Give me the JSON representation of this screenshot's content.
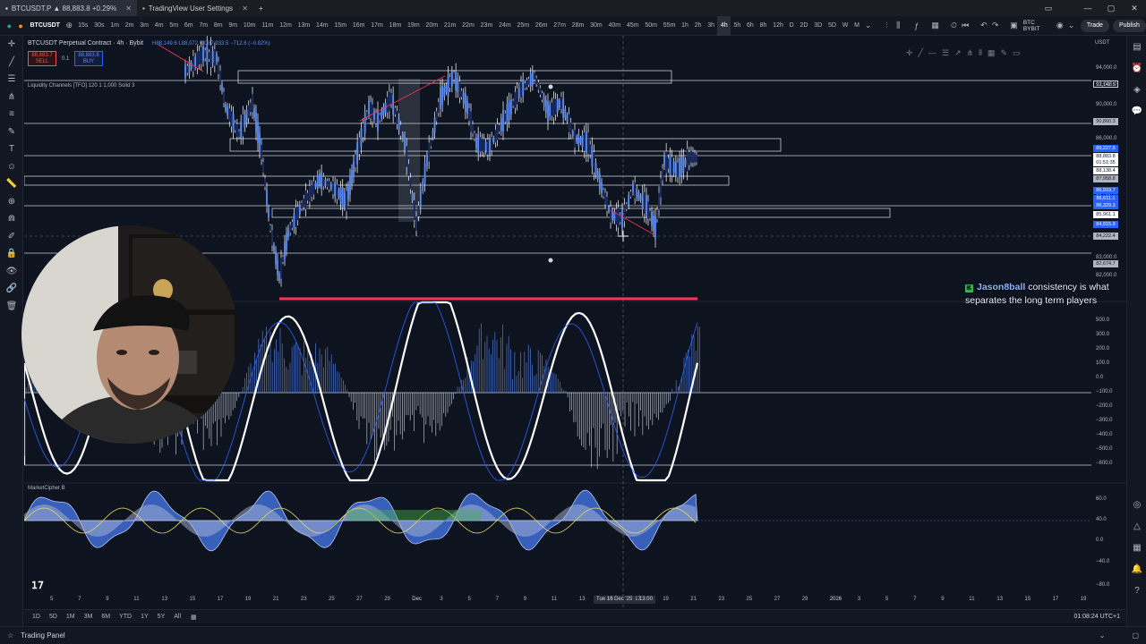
{
  "browser": {
    "tabs": [
      {
        "label": "BTCUSDT.P ▲ 88,883.8 +0.29%"
      },
      {
        "label": "TradingView User Settings"
      }
    ]
  },
  "toolbar": {
    "symbol": "BTCUSDT",
    "timeframes": [
      "15s",
      "30s",
      "1m",
      "2m",
      "3m",
      "4m",
      "5m",
      "6m",
      "7m",
      "8m",
      "9m",
      "10m",
      "11m",
      "12m",
      "13m",
      "14m",
      "15m",
      "16m",
      "17m",
      "18m",
      "19m",
      "20m",
      "21m",
      "22m",
      "23m",
      "24m",
      "25m",
      "26m",
      "27m",
      "28m",
      "30m",
      "40m",
      "45m",
      "50m",
      "55m",
      "1h",
      "2h",
      "3h",
      "4h",
      "5h",
      "6h",
      "8h",
      "12h",
      "D",
      "2D",
      "3D",
      "5D",
      "W",
      "M"
    ],
    "active_timeframe": "4h",
    "exchange_label": "BTC BYBIT",
    "trade_label": "Trade",
    "publish_label": "Publish",
    "currency": "USDT"
  },
  "legend": {
    "title": "BTCUSDT Perpetual Contract · 4h · Bybit",
    "ohlc": "H88,149.6  L88,072.0  C87,933.5 −712.6 (−0.82%)",
    "sell_price": "88,883.7",
    "sell_label": "SELL",
    "spread": "0.1",
    "buy_price": "88,883.8",
    "buy_label": "BUY",
    "indicator": "Liquidity Channels [TFO] 120 1 1,000 Solid 3",
    "oscillator": "MarketCipher B"
  },
  "price_axis": {
    "labels": [
      "94,000.0",
      "92,000.0",
      "90,000.0",
      "88,000.0",
      "86,000.0",
      "84,000.0",
      "83,000.0",
      "82,000.0"
    ],
    "tags": [
      {
        "text": "93,142.5",
        "color": "#d1d4dc",
        "bg": "#d1d4dc"
      },
      {
        "text": "90,860.3",
        "color": "#131722",
        "bg": "#b2b5be"
      },
      {
        "text": "89,227.5",
        "color": "#ffffff",
        "bg": "#2962ff"
      },
      {
        "text": "88,883.8",
        "color": "#131722",
        "bg": "#ffffff"
      },
      {
        "text": "01:51:35",
        "color": "#131722",
        "bg": "#ffffff"
      },
      {
        "text": "88,138.4",
        "color": "#131722",
        "bg": "#ffffff"
      },
      {
        "text": "87,958.8",
        "color": "#131722",
        "bg": "#b2b5be"
      },
      {
        "text": "86,919.7",
        "color": "#ffffff",
        "bg": "#2962ff"
      },
      {
        "text": "86,611.1",
        "color": "#ffffff",
        "bg": "#2962ff"
      },
      {
        "text": "86,329.3",
        "color": "#ffffff",
        "bg": "#2962ff"
      },
      {
        "text": "85,961.1",
        "color": "#131722",
        "bg": "#ffffff"
      },
      {
        "text": "84,915.9",
        "color": "#ffffff",
        "bg": "#2962ff"
      },
      {
        "text": "84,222.4",
        "color": "#131722",
        "bg": "#b2b5be"
      },
      {
        "text": "82,674.7",
        "color": "#131722",
        "bg": "#b2b5be"
      }
    ],
    "osc_labels": [
      "500.0",
      "300.0",
      "200.0",
      "100.0",
      "0.0",
      "−100.0",
      "−200.0",
      "−300.0",
      "−400.0",
      "−500.0",
      "−600.0"
    ],
    "mcb_labels": [
      "60.0",
      "40.0",
      "0.0",
      "−40.0",
      "−80.0"
    ]
  },
  "time_axis": {
    "labels": [
      "5",
      "7",
      "9",
      "11",
      "13",
      "15",
      "17",
      "19",
      "21",
      "23",
      "25",
      "27",
      "29",
      "Dec",
      "3",
      "5",
      "7",
      "9",
      "11",
      "13",
      "15",
      "17",
      "19",
      "21",
      "23",
      "25",
      "27",
      "29",
      "2026",
      "3",
      "5",
      "7",
      "9",
      "11",
      "13",
      "15",
      "17",
      "19"
    ],
    "crosshair_date": "Tue 16 Dec '25",
    "crosshair_time": "13:00"
  },
  "range_bar": {
    "ranges": [
      "1D",
      "5D",
      "1M",
      "3M",
      "6M",
      "YTD",
      "1Y",
      "5Y",
      "All"
    ],
    "clock": "01:08:24 UTC+1"
  },
  "bottom_panel": {
    "label": "Trading Panel"
  },
  "chat": {
    "user": "Jason8ball",
    "message": "consistency is what separates the long term players"
  },
  "colors": {
    "background": "#0e1320",
    "accent": "#2962ff",
    "bull": "#5b8df5",
    "wick": "#ffffff"
  }
}
